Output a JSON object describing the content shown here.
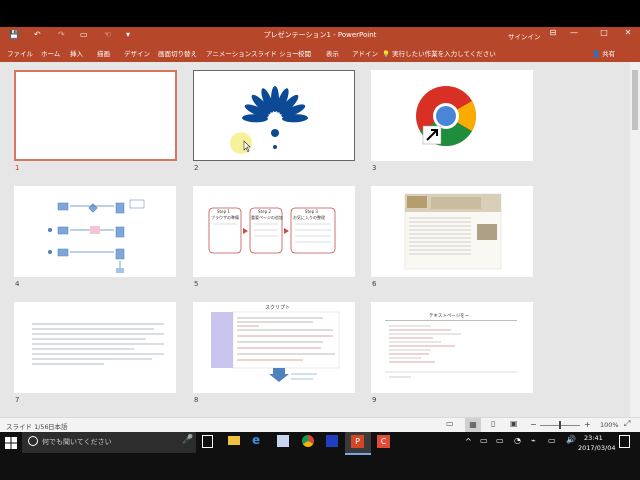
{
  "titlebar": {
    "title": "プレゼンテーション1 - PowerPoint",
    "signin": "サインイン",
    "restore_glyph": "⊟",
    "minimize_glyph": "—",
    "maximize_glyph": "□",
    "close_glyph": "✕",
    "qa_save": "💾",
    "qa_undo": "↶",
    "qa_redo": "↷",
    "qa_touch": "☜",
    "qa_more": "▾"
  },
  "ribbon": {
    "tabs": [
      "ファイル",
      "ホーム",
      "挿入",
      "描画",
      "デザイン",
      "画面切り替え",
      "アニメーション",
      "スライド ショー",
      "校閲",
      "表示",
      "アドイン"
    ],
    "tellme": "実行したい作業を入力してください",
    "share": "共有"
  },
  "slides": [
    {
      "number": "1"
    },
    {
      "number": "2"
    },
    {
      "number": "3"
    },
    {
      "number": "4"
    },
    {
      "number": "5"
    },
    {
      "number": "6"
    },
    {
      "number": "7"
    },
    {
      "number": "8"
    },
    {
      "number": "9"
    }
  ],
  "slide5": {
    "box1_title": "Step 1",
    "box1_sub": "ブラウザの準備",
    "box2_title": "Step 2",
    "box2_sub": "重要ページの追加",
    "box3_title": "Step 3",
    "box3_sub": "お気に入りの整理"
  },
  "slide8": {
    "title": "スクリプト"
  },
  "slide9": {
    "title": "テキストページを一"
  },
  "statusbar": {
    "slide_count": "スライド 1/56",
    "language": "日本語",
    "zoom": "100%"
  },
  "taskbar": {
    "search_placeholder": "何でも聞いてください",
    "time": "23:41",
    "date": "2017/03/04"
  },
  "colors": {
    "accent": "#b7472a",
    "selection": "#d5765e",
    "slide_bg": "#e6e6e6"
  }
}
